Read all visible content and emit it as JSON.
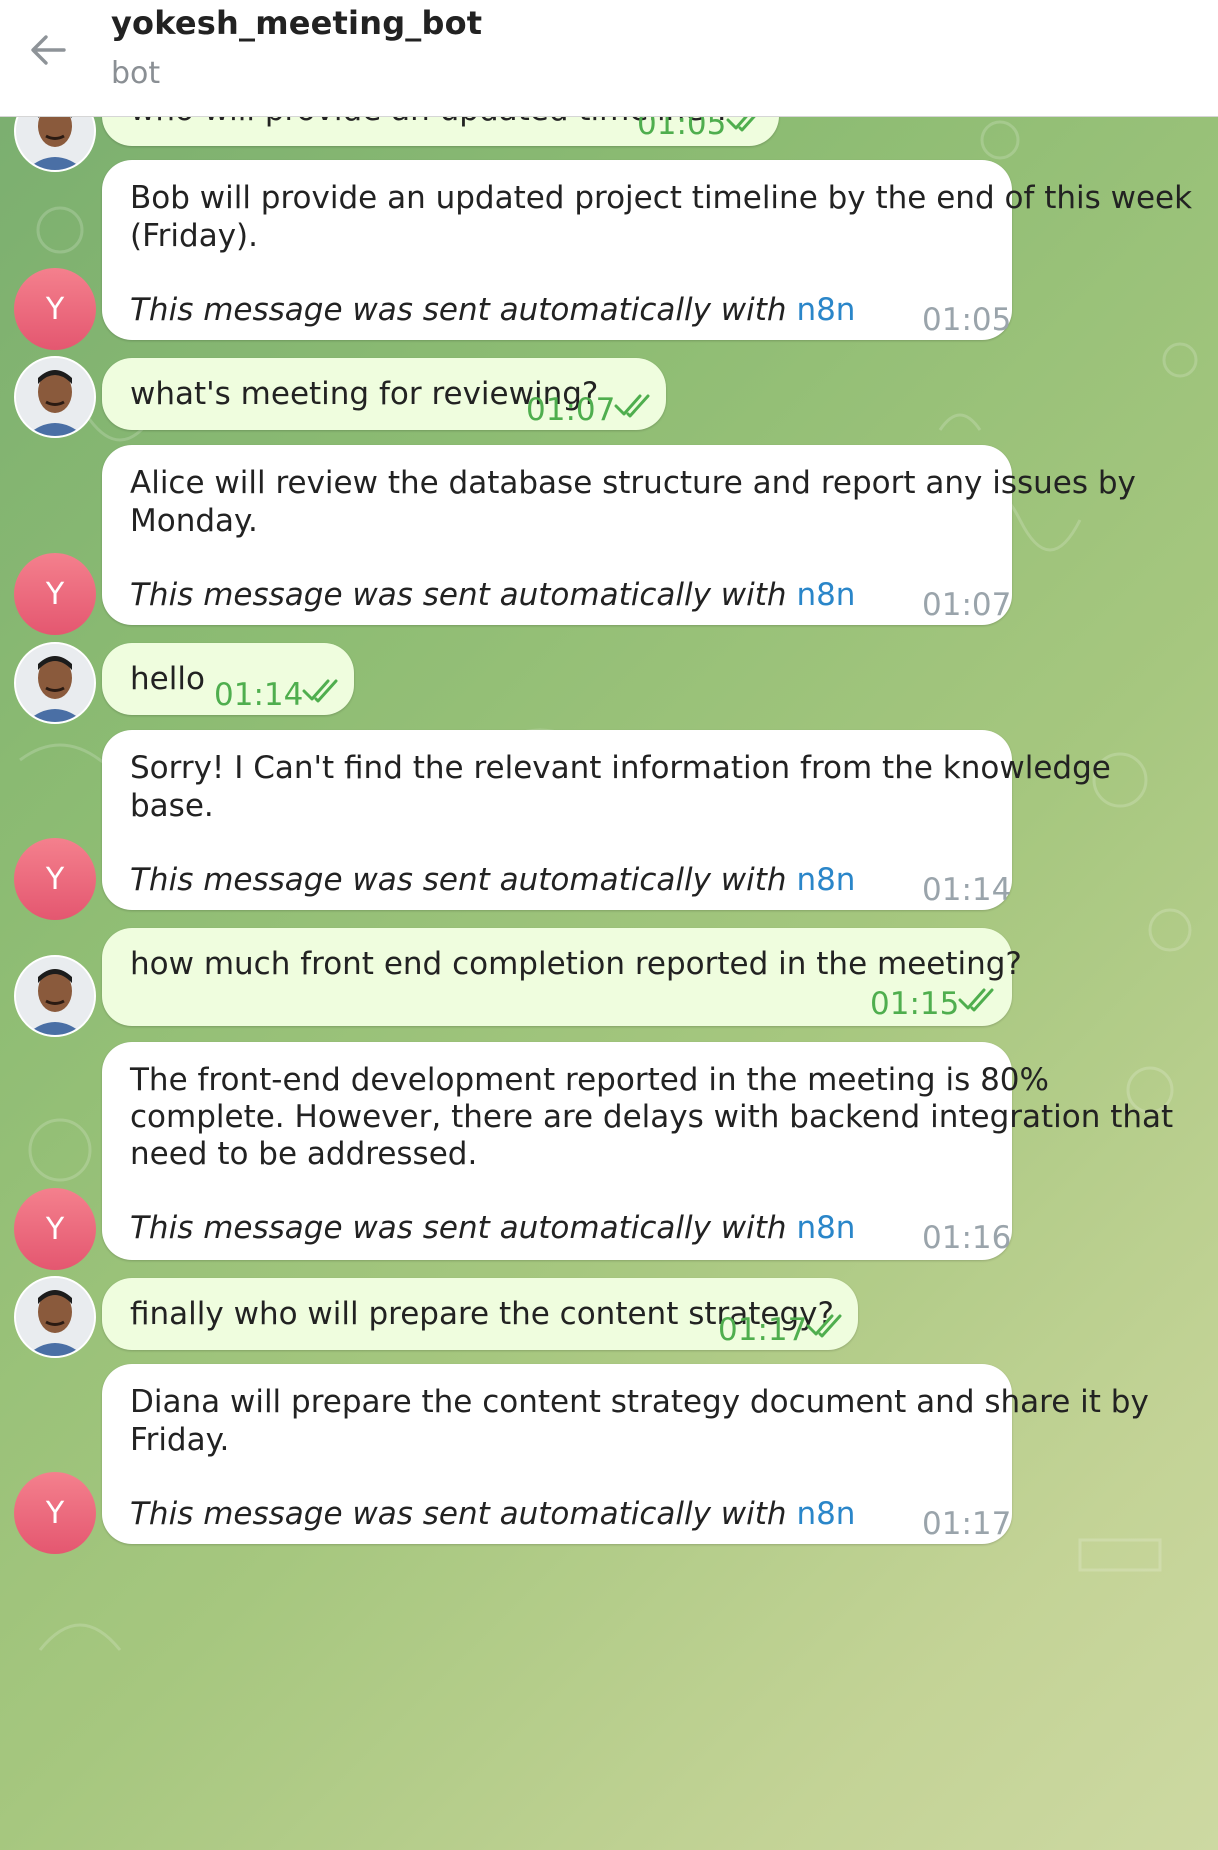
{
  "header": {
    "title": "yokesh_meeting_bot",
    "subtitle": "bot"
  },
  "bot_avatar": {
    "letter": "Y",
    "color": "#e8607a"
  },
  "colors": {
    "outgoing_bubble": "#effdde",
    "incoming_bubble": "#ffffff",
    "link": "#2a86c9",
    "read_check": "#4fae4e"
  },
  "messages": [
    {
      "text": "who will provide an updated timeline ?",
      "time": "01:05"
    },
    {
      "text": "Bob will provide an updated project timeline by the end of this week",
      "text2": "(Friday).",
      "signature": "This message was sent automatically with ",
      "link": "n8n",
      "time": "01:05"
    },
    {
      "text": "what's meeting for reviewing?",
      "time": "01:07"
    },
    {
      "text": "Alice will review the database structure and report any issues by",
      "text2": "Monday.",
      "signature": "This message was sent automatically with ",
      "link": "n8n",
      "time": "01:07"
    },
    {
      "text": "hello",
      "time": "01:14"
    },
    {
      "text": "Sorry! I Can't find the relevant information from the knowledge",
      "text2": "base.",
      "signature": "This message was sent automatically with ",
      "link": "n8n",
      "time": "01:14"
    },
    {
      "text": "how much front end completion reported in the meeting?",
      "time": "01:15"
    },
    {
      "text": "The front-end development reported in the meeting is 80%",
      "text2": "complete. However, there are delays with backend integration that",
      "text3": "need to be addressed.",
      "signature": "This message was sent automatically with ",
      "link": "n8n",
      "time": "01:16"
    },
    {
      "text": "finally who will prepare the content strategy?",
      "time": "01:17"
    },
    {
      "text": "Diana will prepare the content strategy document and share it by",
      "text2": "Friday.",
      "signature": "This message was sent automatically with ",
      "link": "n8n",
      "time": "01:17"
    }
  ]
}
